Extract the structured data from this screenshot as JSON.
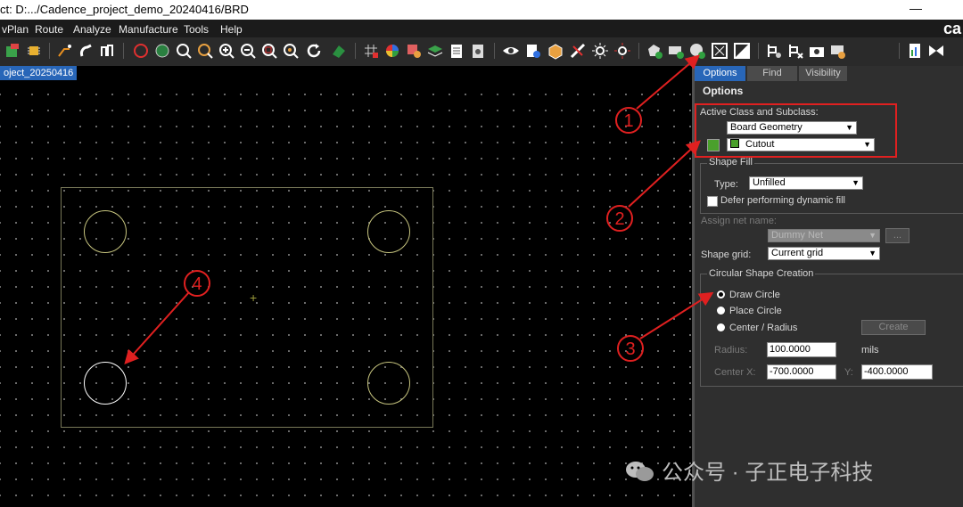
{
  "window": {
    "title": "ct: D:.../Cadence_project_demo_20240416/BRD",
    "minimize_glyph": "—"
  },
  "menubar": {
    "items": [
      "vPlan",
      "Route",
      "Analyze",
      "Manufacture",
      "Tools",
      "Help"
    ],
    "logo_text": "ca"
  },
  "toolbar": {
    "icons": [
      "component-icon",
      "chip-icon",
      "route-icon",
      "hand-route-icon",
      "fanout-icon",
      "drc-icon",
      "zoom-world-icon",
      "zoom-fit-icon",
      "zoom-prev-icon",
      "zoom-in-icon",
      "zoom-out-icon",
      "zoom-window-icon",
      "zoom-center-icon",
      "redraw-icon",
      "layer-icon",
      "grid-icon",
      "color-icon",
      "shadow-icon",
      "stack-icon",
      "sheet-icon",
      "settings-icon",
      "view-icon",
      "info-icon",
      "3d-icon",
      "measure-icon",
      "light-icon",
      "highlight-icon",
      "add-polygon-icon",
      "add-rect-icon",
      "add-circle-icon",
      "select-shape-icon",
      "merge-icon",
      "place-icon",
      "mirror-icon",
      "camera-icon",
      "report-icon",
      "report2-icon",
      "swap-icon"
    ]
  },
  "document_tab": {
    "label": "oject_20250416"
  },
  "panel": {
    "tabs": [
      "Options",
      "Find",
      "Visibility"
    ],
    "title": "Options",
    "active_class_label": "Active Class and Subclass:",
    "class_value": "Board Geometry",
    "subclass_value": "Cutout",
    "shape_fill": {
      "legend": "Shape Fill",
      "type_label": "Type:",
      "type_value": "Unfilled",
      "defer_label": "Defer performing dynamic fill",
      "defer_checked": false
    },
    "assign_net_label": "Assign net name:",
    "net_value": "Dummy Net",
    "browse_label": "...",
    "shape_grid_label": "Shape grid:",
    "shape_grid_value": "Current grid",
    "circular": {
      "legend": "Circular Shape Creation",
      "options": [
        "Draw Circle",
        "Place Circle",
        "Center / Radius"
      ],
      "selected": "Draw Circle",
      "create_label": "Create",
      "radius_label": "Radius:",
      "radius_value": "100.0000",
      "radius_unit": "mils",
      "center_x_label": "Center X:",
      "center_x_value": "-700.0000",
      "y_label": "Y:",
      "y_value": "-400.0000"
    }
  },
  "callouts": [
    "1",
    "2",
    "3",
    "4"
  ],
  "watermark": {
    "text": "公众号 · 子正电子科技"
  },
  "colors": {
    "accent_tab": "#2866b8",
    "callout_red": "#e02020",
    "board_outline": "#787858",
    "cutout_green": "#4aa02c"
  }
}
